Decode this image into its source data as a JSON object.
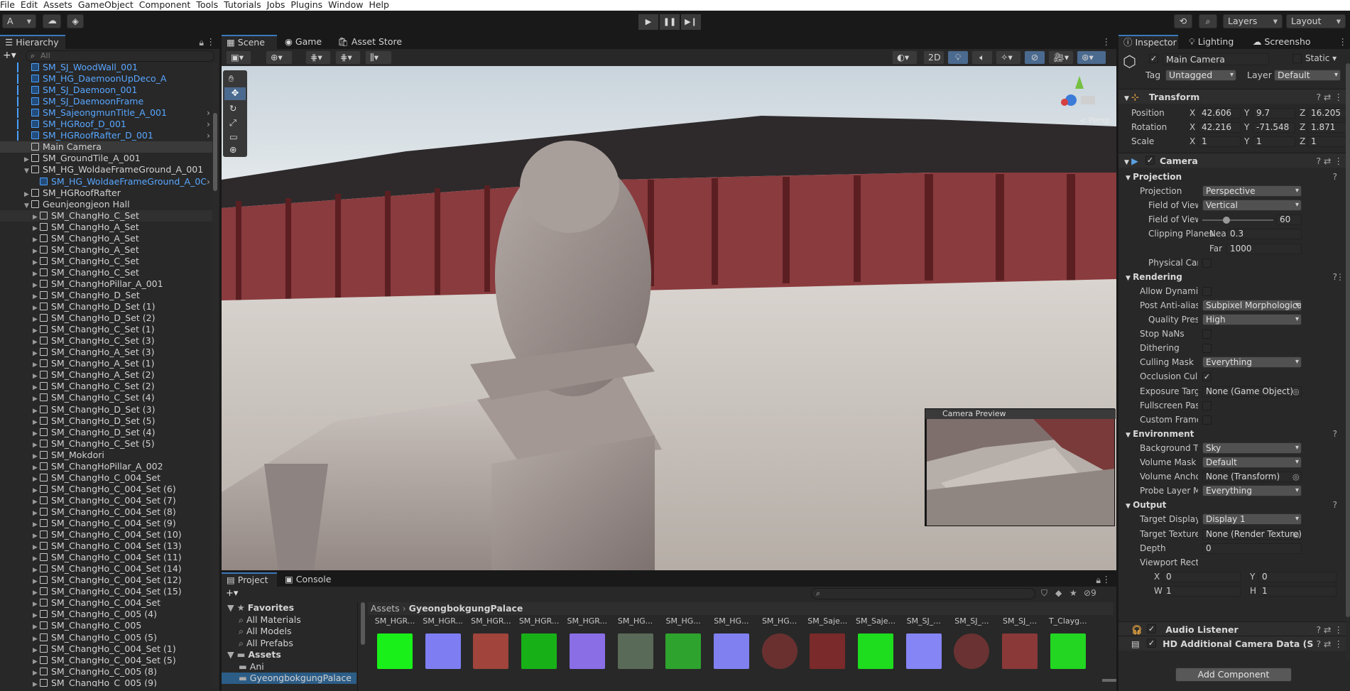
{
  "menu": [
    "File",
    "Edit",
    "Assets",
    "GameObject",
    "Component",
    "Tools",
    "Tutorials",
    "Jobs",
    "Plugins",
    "Window",
    "Help"
  ],
  "toolbar": {
    "account": "A",
    "layers": "Layers",
    "layout": "Layout"
  },
  "hierarchy": {
    "title": "Hierarchy",
    "search_placeholder": "All",
    "rows": [
      {
        "label": "SM_SJ_WoodWall_001",
        "indent": 1,
        "color": "blue",
        "arrow": ""
      },
      {
        "label": "SM_HG_DaemoonUpDeco_A",
        "indent": 1,
        "color": "blue",
        "arrow": ""
      },
      {
        "label": "SM_SJ_Daemoon_001",
        "indent": 1,
        "color": "blue",
        "arrow": ""
      },
      {
        "label": "SM_SJ_DaemoonFrame",
        "indent": 1,
        "color": "blue",
        "arrow": ""
      },
      {
        "label": "SM_SajeongmunTitle_A_001",
        "indent": 1,
        "color": "blue",
        "arrow": ">"
      },
      {
        "label": "SM_HGRoof_D_001",
        "indent": 1,
        "color": "blue",
        "arrow": ">"
      },
      {
        "label": "SM_HGRoofRafter_D_001",
        "indent": 1,
        "color": "blue",
        "arrow": ">"
      },
      {
        "label": "Main Camera",
        "indent": 1,
        "color": "white",
        "arrow": "",
        "selected": true
      },
      {
        "label": "SM_GroundTile_A_001",
        "indent": 1,
        "color": "white",
        "arrow": "▶"
      },
      {
        "label": "SM_HG_WoldaeFrameGround_A_001",
        "indent": 1,
        "color": "white",
        "arrow": "▼"
      },
      {
        "label": "SM_HG_WoldaeFrameGround_A_0C",
        "indent": 2,
        "color": "blue",
        "arrow": ">"
      },
      {
        "label": "SM_HGRoofRafter",
        "indent": 1,
        "color": "white",
        "arrow": "▶"
      },
      {
        "label": "Geunjeongjeon Hall",
        "indent": 1,
        "color": "white",
        "arrow": "▼"
      },
      {
        "label": "SM_ChangHo_C_Set",
        "indent": 2,
        "color": "white",
        "arrow": "▶",
        "hover": true
      },
      {
        "label": "SM_ChangHo_A_Set",
        "indent": 2,
        "color": "white",
        "arrow": "▶"
      },
      {
        "label": "SM_ChangHo_A_Set",
        "indent": 2,
        "color": "white",
        "arrow": "▶"
      },
      {
        "label": "SM_ChangHo_A_Set",
        "indent": 2,
        "color": "white",
        "arrow": "▶"
      },
      {
        "label": "SM_ChangHo_C_Set",
        "indent": 2,
        "color": "white",
        "arrow": "▶"
      },
      {
        "label": "SM_ChangHo_C_Set",
        "indent": 2,
        "color": "white",
        "arrow": "▶"
      },
      {
        "label": "SM_ChangHoPillar_A_001",
        "indent": 2,
        "color": "white",
        "arrow": "▶"
      },
      {
        "label": "SM_ChangHo_D_Set",
        "indent": 2,
        "color": "white",
        "arrow": "▶"
      },
      {
        "label": "SM_ChangHo_D_Set (1)",
        "indent": 2,
        "color": "white",
        "arrow": "▶"
      },
      {
        "label": "SM_ChangHo_D_Set (2)",
        "indent": 2,
        "color": "white",
        "arrow": "▶"
      },
      {
        "label": "SM_ChangHo_C_Set (1)",
        "indent": 2,
        "color": "white",
        "arrow": "▶"
      },
      {
        "label": "SM_ChangHo_C_Set (3)",
        "indent": 2,
        "color": "white",
        "arrow": "▶"
      },
      {
        "label": "SM_ChangHo_A_Set (3)",
        "indent": 2,
        "color": "white",
        "arrow": "▶"
      },
      {
        "label": "SM_ChangHo_A_Set (1)",
        "indent": 2,
        "color": "white",
        "arrow": "▶"
      },
      {
        "label": "SM_ChangHo_A_Set (2)",
        "indent": 2,
        "color": "white",
        "arrow": "▶"
      },
      {
        "label": "SM_ChangHo_C_Set (2)",
        "indent": 2,
        "color": "white",
        "arrow": "▶"
      },
      {
        "label": "SM_ChangHo_C_Set (4)",
        "indent": 2,
        "color": "white",
        "arrow": "▶"
      },
      {
        "label": "SM_ChangHo_D_Set (3)",
        "indent": 2,
        "color": "white",
        "arrow": "▶"
      },
      {
        "label": "SM_ChangHo_D_Set (5)",
        "indent": 2,
        "color": "white",
        "arrow": "▶"
      },
      {
        "label": "SM_ChangHo_D_Set (4)",
        "indent": 2,
        "color": "white",
        "arrow": "▶"
      },
      {
        "label": "SM_ChangHo_C_Set (5)",
        "indent": 2,
        "color": "white",
        "arrow": "▶"
      },
      {
        "label": "SM_Mokdori",
        "indent": 2,
        "color": "white",
        "arrow": "▶"
      },
      {
        "label": "SM_ChangHoPillar_A_002",
        "indent": 2,
        "color": "white",
        "arrow": "▶"
      },
      {
        "label": "SM_ChangHo_C_004_Set",
        "indent": 2,
        "color": "white",
        "arrow": "▶"
      },
      {
        "label": "SM_ChangHo_C_004_Set (6)",
        "indent": 2,
        "color": "white",
        "arrow": "▶"
      },
      {
        "label": "SM_ChangHo_C_004_Set (7)",
        "indent": 2,
        "color": "white",
        "arrow": "▶"
      },
      {
        "label": "SM_ChangHo_C_004_Set (8)",
        "indent": 2,
        "color": "white",
        "arrow": "▶"
      },
      {
        "label": "SM_ChangHo_C_004_Set (9)",
        "indent": 2,
        "color": "white",
        "arrow": "▶"
      },
      {
        "label": "SM_ChangHo_C_004_Set (10)",
        "indent": 2,
        "color": "white",
        "arrow": "▶"
      },
      {
        "label": "SM_ChangHo_C_004_Set (13)",
        "indent": 2,
        "color": "white",
        "arrow": "▶"
      },
      {
        "label": "SM_ChangHo_C_004_Set (11)",
        "indent": 2,
        "color": "white",
        "arrow": "▶"
      },
      {
        "label": "SM_ChangHo_C_004_Set (14)",
        "indent": 2,
        "color": "white",
        "arrow": "▶"
      },
      {
        "label": "SM_ChangHo_C_004_Set (12)",
        "indent": 2,
        "color": "white",
        "arrow": "▶"
      },
      {
        "label": "SM_ChangHo_C_004_Set (15)",
        "indent": 2,
        "color": "white",
        "arrow": "▶"
      },
      {
        "label": "SM_ChangHo_C_004_Set",
        "indent": 2,
        "color": "white",
        "arrow": "▶"
      },
      {
        "label": "SM_ChangHo_C_005 (4)",
        "indent": 2,
        "color": "white",
        "arrow": "▶"
      },
      {
        "label": "SM_ChangHo_C_005",
        "indent": 2,
        "color": "white",
        "arrow": "▶"
      },
      {
        "label": "SM_ChangHo_C_005 (5)",
        "indent": 2,
        "color": "white",
        "arrow": "▶"
      },
      {
        "label": "SM_ChangHo_C_004_Set (1)",
        "indent": 2,
        "color": "white",
        "arrow": "▶"
      },
      {
        "label": "SM_ChangHo_C_004_Set  (5)",
        "indent": 2,
        "color": "white",
        "arrow": "▶"
      },
      {
        "label": "SM_ChangHo_C_005 (8)",
        "indent": 2,
        "color": "white",
        "arrow": "▶"
      },
      {
        "label": "SM_ChangHo_C_005 (9)",
        "indent": 2,
        "color": "white",
        "arrow": "▶"
      }
    ]
  },
  "scene": {
    "tabs": [
      "Scene",
      "Game",
      "Asset Store"
    ],
    "mode_2d": "2D",
    "persp_label": "< Persp",
    "camera_preview_title": "Camera Preview"
  },
  "project": {
    "tabs": [
      "Project",
      "Console"
    ],
    "badge": "9",
    "tree": [
      {
        "label": "Favorites",
        "level": 0
      },
      {
        "label": "All Materials",
        "level": 1
      },
      {
        "label": "All Models",
        "level": 1
      },
      {
        "label": "All Prefabs",
        "level": 1
      },
      {
        "label": "Assets",
        "level": 0
      },
      {
        "label": "Ani",
        "level": 1
      },
      {
        "label": "GyeongbokgungPalace",
        "level": 1
      }
    ],
    "breadcrumb": [
      "Assets",
      "GyeongbokgungPalace"
    ],
    "assets": [
      {
        "label": "SM_HGR...",
        "color": "#19f019"
      },
      {
        "label": "SM_HGR...",
        "color": "#7e7ef2"
      },
      {
        "label": "SM_HGR...",
        "color": "#a0443c"
      },
      {
        "label": "SM_HGR...",
        "color": "#17b017"
      },
      {
        "label": "SM_HGR...",
        "color": "#8a6ee6"
      },
      {
        "label": "SM_HG...",
        "color": "#5a6a58"
      },
      {
        "label": "SM_HG...",
        "color": "#2ea32e"
      },
      {
        "label": "SM_HG...",
        "color": "#8080f0"
      },
      {
        "label": "SM_HG...",
        "color": "#6a3030"
      },
      {
        "label": "SM_Saje...",
        "color": "#7a2a2a"
      },
      {
        "label": "SM_Saje...",
        "color": "#1edc1e"
      },
      {
        "label": "SM_SJ_...",
        "color": "#8585f5"
      },
      {
        "label": "SM_SJ_...",
        "color": "#6a3232"
      },
      {
        "label": "SM_SJ_...",
        "color": "#8a3838"
      },
      {
        "label": "T_Clayg...",
        "color": "#22d622"
      }
    ]
  },
  "inspector": {
    "tabs": [
      "Inspector",
      "Lighting",
      "Screensho"
    ],
    "object_name": "Main Camera",
    "static_label": "Static",
    "tag_label": "Tag",
    "tag_value": "Untagged",
    "layer_label": "Layer",
    "layer_value": "Default",
    "transform": {
      "title": "Transform",
      "position_label": "Position",
      "position": {
        "x": "42.606",
        "y": "9.7",
        "z": "16.205"
      },
      "rotation_label": "Rotation",
      "rotation": {
        "x": "42.216",
        "y": "-71.548",
        "z": "1.871"
      },
      "scale_label": "Scale",
      "scale": {
        "x": "1",
        "y": "1",
        "z": "1"
      }
    },
    "camera": {
      "title": "Camera",
      "projection_header": "Projection",
      "projection_label": "Projection",
      "projection_value": "Perspective",
      "fov_axis_label": "Field of View Ax",
      "fov_axis_value": "Vertical",
      "fov_label": "Field of View",
      "fov_value": "60",
      "fov_fraction": 0.34,
      "clip_label": "Clipping Planes",
      "near_label": "Near",
      "near_value": "0.3",
      "far_label": "Far",
      "far_value": "1000",
      "physical_label": "Physical Camer",
      "rendering_header": "Rendering",
      "dynamic_res_label": "Allow Dynamic Re:",
      "aa_label": "Post Anti-aliasing",
      "aa_value": "Subpixel Morphological Anti",
      "quality_label": "Quality Preset",
      "quality_value": "High",
      "stop_nans_label": "Stop NaNs",
      "dithering_label": "Dithering",
      "culling_label": "Culling Mask",
      "culling_value": "Everything",
      "occlusion_label": "Occlusion Culling",
      "exposure_label": "Exposure Target",
      "exposure_value": "None (Game Object)",
      "fullscreen_label": "Fullscreen Passthr",
      "custom_frame_label": "Custom Frame Set",
      "environment_header": "Environment",
      "bg_label": "Background Type",
      "bg_value": "Sky",
      "volume_mask_label": "Volume Mask",
      "volume_mask_value": "Default",
      "volume_anchor_label": "Volume Anchor Ov",
      "volume_anchor_value": "None (Transform)",
      "probe_label": "Probe Layer Mask",
      "probe_value": "Everything",
      "output_header": "Output",
      "target_display_label": "Target Display",
      "target_display_value": "Display 1",
      "target_texture_label": "Target Texture",
      "target_texture_value": "None (Render Texture)",
      "depth_label": "Depth",
      "depth_value": "0",
      "viewport_label": "Viewport Rect",
      "vp_x": "0",
      "vp_y": "0",
      "vp_w": "1",
      "vp_h": "1"
    },
    "audio_title": "Audio Listener",
    "hd_title": "HD Additional Camera Data (Scrip",
    "add_component": "Add Component"
  }
}
